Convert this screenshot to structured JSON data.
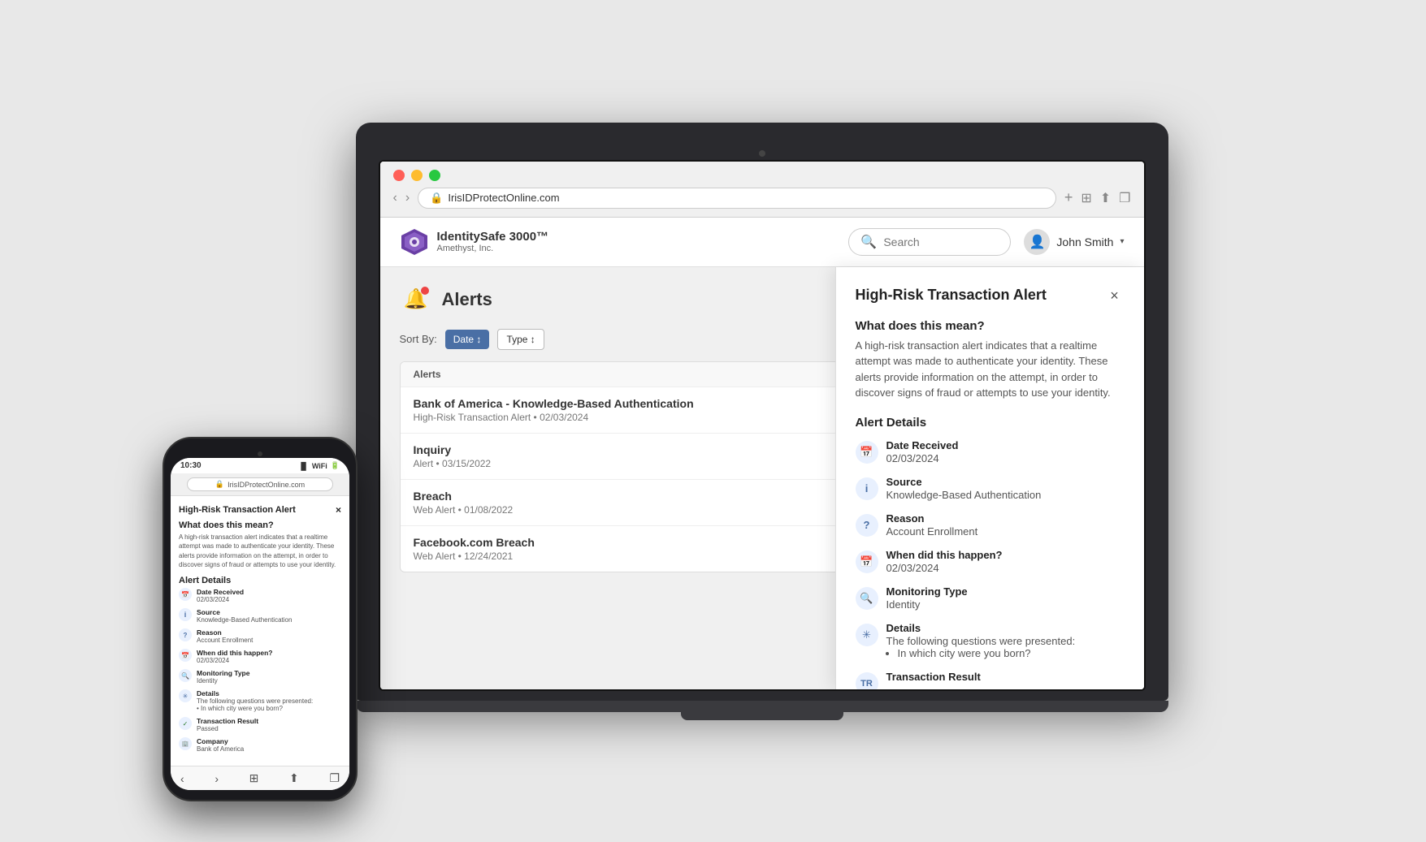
{
  "laptop": {
    "browser": {
      "url": "IrisIDProtectOnline.com",
      "back_arrow": "‹",
      "forward_arrow": "›",
      "lock_icon": "🔒",
      "add_tab": "+",
      "actions": [
        "⊞",
        "⬆",
        "❐"
      ]
    },
    "header": {
      "logo_text": "IdentitySafe 3000™",
      "company": "Amethyst, Inc.",
      "search_placeholder": "Search",
      "user_name": "John Smith",
      "chevron": "▾"
    },
    "alerts_page": {
      "title": "Alerts",
      "sort_label": "Sort By:",
      "sort_buttons": [
        "Date ↕",
        "Type ↕"
      ],
      "section_label": "Alerts",
      "items": [
        {
          "title": "Bank of America - Knowledge-Based Authentication",
          "sub": "High-Risk Transaction Alert • 02/03/2024"
        },
        {
          "title": "Inquiry",
          "sub": "Alert • 03/15/2022"
        },
        {
          "title": "Breach",
          "sub": "Web Alert • 01/08/2022"
        },
        {
          "title": "Facebook.com Breach",
          "sub": "Web Alert • 12/24/2021"
        }
      ]
    },
    "panel": {
      "title": "High-Risk Transaction Alert",
      "close": "×",
      "what_label": "What does this mean?",
      "what_desc": "A high-risk transaction alert indicates that a realtime attempt was made to authenticate your identity. These alerts provide information on the attempt, in order to discover signs of fraud or attempts to use your identity.",
      "details_label": "Alert Details",
      "details": [
        {
          "icon": "📅",
          "label": "Date Received",
          "value": "02/03/2024"
        },
        {
          "icon": "ℹ",
          "label": "Source",
          "value": "Knowledge-Based Authentication"
        },
        {
          "icon": "?",
          "label": "Reason",
          "value": "Account Enrollment"
        },
        {
          "icon": "📅",
          "label": "When did this happen?",
          "value": "02/03/2024"
        },
        {
          "icon": "🔍",
          "label": "Monitoring Type",
          "value": "Identity"
        },
        {
          "icon": "✳",
          "label": "Details",
          "value_lines": [
            "The following questions were presented:",
            "• In which city were you born?"
          ]
        },
        {
          "icon": "✓",
          "label": "Transaction Result",
          "value": ""
        },
        {
          "icon": "🏢",
          "label": "Transaction Result",
          "value": ""
        }
      ]
    }
  },
  "phone": {
    "status_time": "10:30",
    "url": "IrisIDProtectOnline.com",
    "panel": {
      "title": "High-Risk Transaction Alert",
      "close": "×",
      "what_label": "What does this mean?",
      "what_desc": "A high-risk transaction alert indicates that a realtime attempt was made to authenticate your identity. These alerts provide information on the attempt, in order to discover signs of fraud or attempts to use your identity.",
      "details_label": "Alert Details",
      "details": [
        {
          "icon": "📅",
          "label": "Date Received",
          "value": "02/03/2024"
        },
        {
          "icon": "ℹ",
          "label": "Source",
          "value": "Knowledge-Based Authentication"
        },
        {
          "icon": "?",
          "label": "Reason",
          "value": "Account Enrollment"
        },
        {
          "icon": "📅",
          "label": "When did this happen?",
          "value": "02/03/2024"
        },
        {
          "icon": "🔍",
          "label": "Monitoring Type",
          "value": "Identity"
        },
        {
          "icon": "✳",
          "label": "Details",
          "value": "The following questions were presented: • In which city were you born?"
        },
        {
          "icon": "✓",
          "label": "Transaction Result",
          "value": "Passed"
        },
        {
          "icon": "🏢",
          "label": "Company",
          "value": "Bank of America"
        }
      ]
    }
  }
}
